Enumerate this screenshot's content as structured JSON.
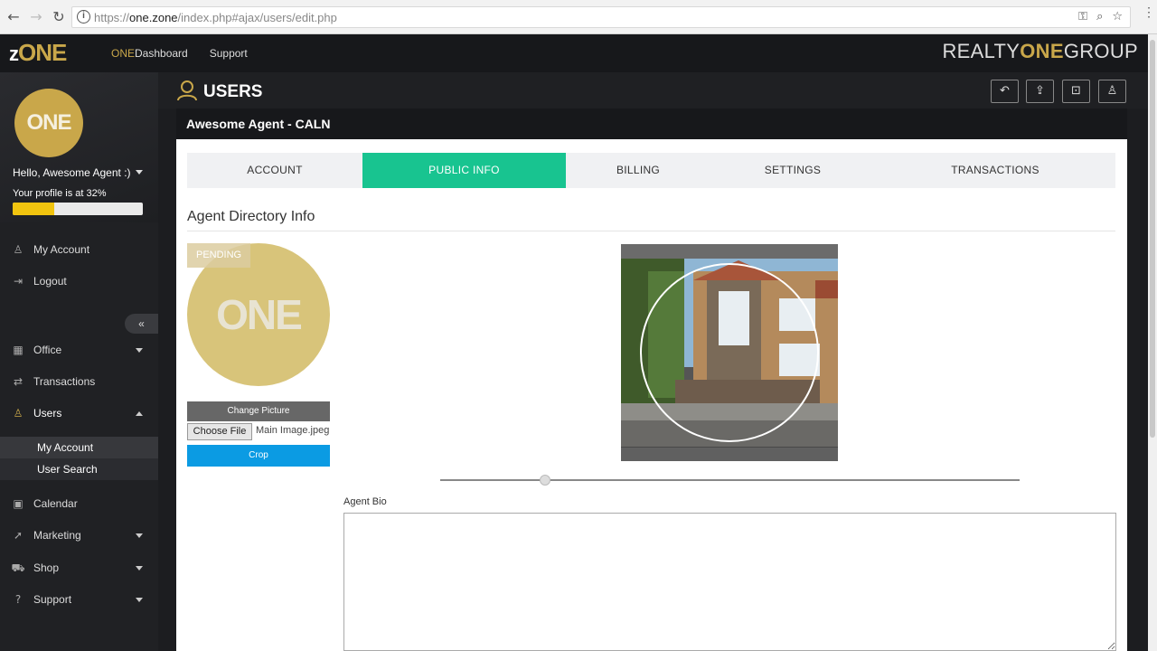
{
  "browser": {
    "url_scheme": "https://",
    "url_host": "one.zone",
    "url_path": "/index.php#ajax/users/edit.php"
  },
  "topbar": {
    "logo_z": "z",
    "logo_rest": "ONE",
    "nav_one": "ONE",
    "nav_dashboard": "Dashboard",
    "nav_support": "Support",
    "brand_realty": "REALTY",
    "brand_one": "ONE",
    "brand_group": "GROUP"
  },
  "sidebar": {
    "avatar_text": "ONE",
    "greeting": "Hello, Awesome Agent :)",
    "profile_text": "Your profile is at 32%",
    "profile_percent": 32,
    "collapse_icon": "«",
    "items": [
      {
        "label": "My Account",
        "icon": "user-icon"
      },
      {
        "label": "Logout",
        "icon": "logout-icon"
      },
      {
        "label": "Office",
        "icon": "building-icon"
      },
      {
        "label": "Transactions",
        "icon": "exchange-icon"
      },
      {
        "label": "Users",
        "icon": "user-icon"
      },
      {
        "label": "Calendar",
        "icon": "calendar-icon"
      },
      {
        "label": "Marketing",
        "icon": "rocket-icon"
      },
      {
        "label": "Shop",
        "icon": "cart-icon"
      },
      {
        "label": "Support",
        "icon": "help-icon"
      }
    ],
    "sub_items": [
      {
        "label": "My Account"
      },
      {
        "label": "User Search"
      }
    ]
  },
  "main": {
    "title": "USERS",
    "agent_name": "Awesome Agent - CALN",
    "tabs": [
      {
        "label": "ACCOUNT"
      },
      {
        "label": "PUBLIC INFO"
      },
      {
        "label": "BILLING"
      },
      {
        "label": "SETTINGS"
      },
      {
        "label": "TRANSACTIONS"
      }
    ],
    "active_tab": "PUBLIC INFO",
    "section_title": "Agent Directory Info",
    "pending_label": "PENDING",
    "profile_pic_text": "ONE",
    "change_picture_label": "Change Picture",
    "choose_file_label": "Choose File",
    "file_name": "Main Image.jpeg",
    "crop_label": "Crop",
    "bio_label": "Agent Bio",
    "bio_value": ""
  },
  "colors": {
    "accent_gold": "#c9a74a",
    "tab_active": "#18c490",
    "crop_button": "#0b9be3",
    "progress": "#f1c40f"
  }
}
